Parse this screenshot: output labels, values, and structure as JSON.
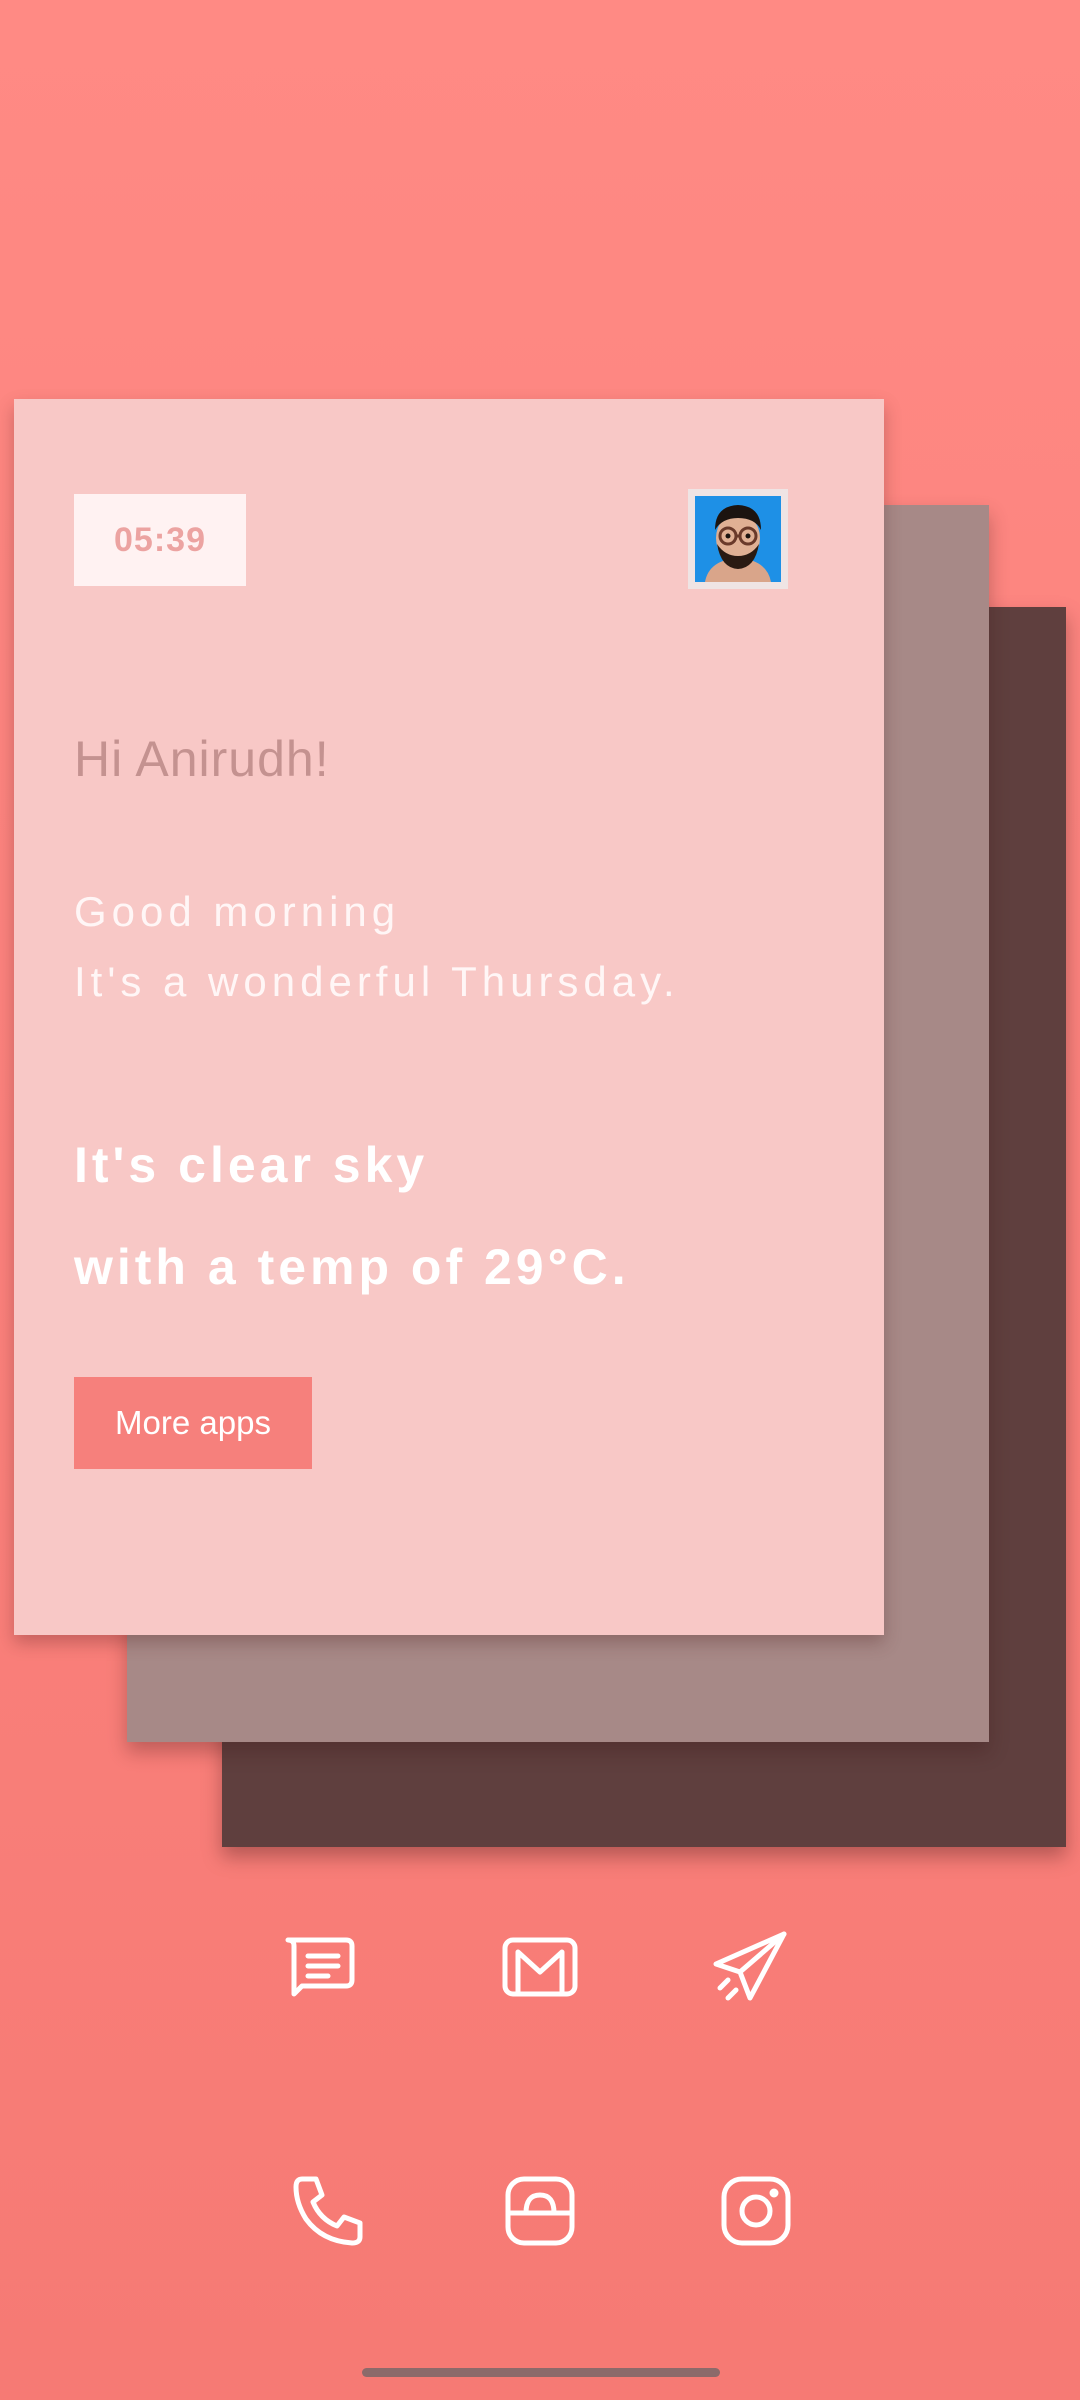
{
  "widget": {
    "time": "05:39",
    "greeting": "Hi Anirudh!",
    "line1": "Good morning",
    "line2": "It's a wonderful Thursday.",
    "weather_line1": "It's clear sky",
    "weather_line2": "with a temp of 29°C.",
    "more_apps_label": "More apps"
  },
  "dock": {
    "row1": [
      "messages-icon",
      "gmail-icon",
      "telegram-icon"
    ],
    "row2": [
      "phone-icon",
      "store-icon",
      "instagram-icon"
    ]
  },
  "colors": {
    "background": "#fb827d",
    "card_light": "#f8c8c6",
    "card_mid": "#a78987",
    "card_dark": "#5f3f3e",
    "accent": "#f6807c"
  }
}
